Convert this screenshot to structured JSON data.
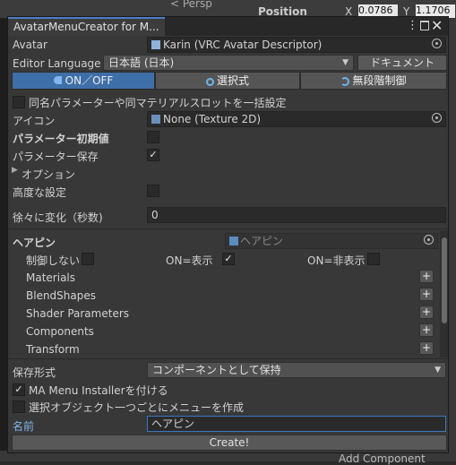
{
  "background": {
    "scene_persp": "< Persp",
    "position_label": "Position",
    "x_label": "X",
    "x_value": "0.0786",
    "y_label": "Y",
    "y_value": "1.1706",
    "add_component": "Add Component"
  },
  "window": {
    "title": "AvatarMenuCreator for M...",
    "menu_glyph": "⋮",
    "close_glyph": "✕"
  },
  "form": {
    "avatar_label": "Avatar",
    "avatar_value": "Karin (VRC Avatar Descriptor)",
    "editor_language_label": "Editor Language",
    "editor_language_value": "日本語 (日本)",
    "document_button": "ドキュメント",
    "mode_tabs": [
      {
        "label": "ON／OFF",
        "selected": true
      },
      {
        "label": "選択式",
        "selected": false
      },
      {
        "label": "無段階制御",
        "selected": false
      }
    ],
    "bulk_checkbox_label": "同名パラメーターや同マテリアルスロットを一括設定",
    "bulk_checked": false,
    "icon_label": "アイコン",
    "icon_value": "None (Texture 2D)",
    "param_initial_label": "パラメーター初期値",
    "param_initial_checked": false,
    "param_save_label": "パラメーター保存",
    "param_save_checked": true,
    "options_label": "オプション",
    "advanced_label": "高度な設定",
    "advanced_checked": false,
    "transition_label": "徐々に変化（秒数)",
    "transition_value": "0"
  },
  "object_section": {
    "name": "ヘアピン",
    "object_field": "ヘアピン",
    "no_control_label": "制御しない",
    "no_control_checked": false,
    "on_show_label": "ON=表示",
    "on_show_checked": true,
    "on_hide_label": "ON=非表示",
    "on_hide_checked": false,
    "categories": [
      "Materials",
      "BlendShapes",
      "Shader Parameters",
      "Components",
      "Transform"
    ],
    "plus_glyph": "+"
  },
  "footer": {
    "save_format_label": "保存形式",
    "save_format_value": "コンポーネントとして保持",
    "ma_installer_label": "MA Menu Installerを付ける",
    "ma_installer_checked": true,
    "per_object_label": "選択オブジェクト一つごとにメニューを作成",
    "per_object_checked": false,
    "name_label": "名前",
    "name_value": "ヘアピン",
    "create_button": "Create!"
  },
  "colors": {
    "accent": "#4d7fc4",
    "selected_tab": "#3f6fa8",
    "name_border": "#3a79bb"
  }
}
